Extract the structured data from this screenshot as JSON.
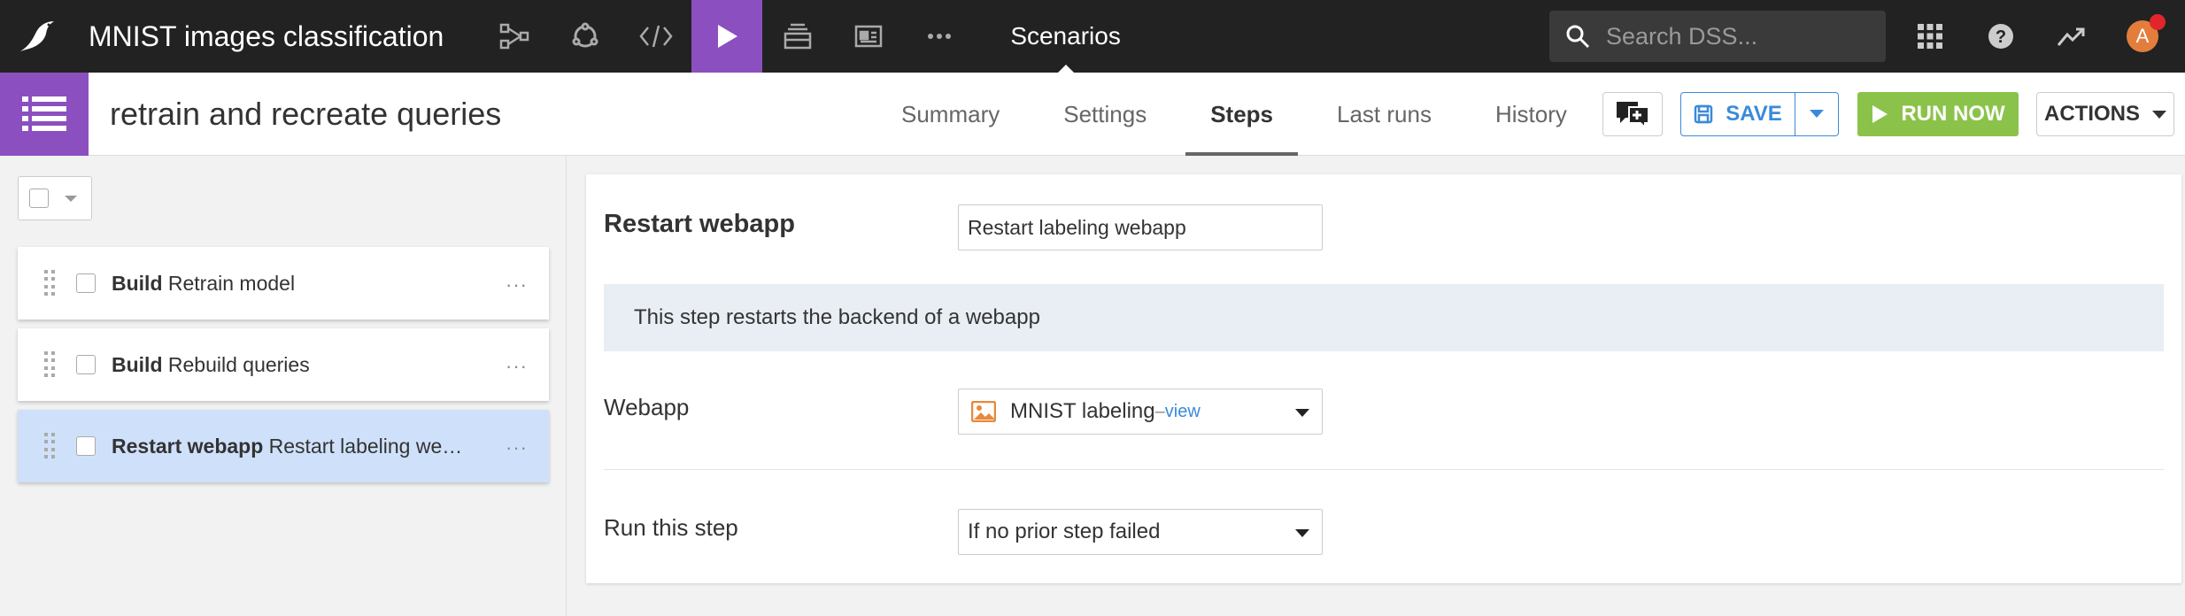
{
  "topnav": {
    "project_title": "MNIST images classification",
    "section": "Scenarios",
    "search_placeholder": "Search DSS...",
    "avatar_initial": "A",
    "icons": [
      "flow-icon",
      "lab-icon",
      "code-icon",
      "play-icon",
      "jobs-icon",
      "dashboard-icon",
      "more-icon"
    ]
  },
  "subheader": {
    "scenario_title": "retrain and recreate queries",
    "tabs": [
      "Summary",
      "Settings",
      "Steps",
      "Last runs",
      "History"
    ],
    "active_tab": "Steps",
    "save_label": "SAVE",
    "run_label": "RUN NOW",
    "actions_label": "ACTIONS"
  },
  "steps": [
    {
      "type": "Build",
      "name": "Retrain model",
      "selected": false
    },
    {
      "type": "Build",
      "name": "Rebuild queries",
      "selected": false
    },
    {
      "type": "Restart webapp",
      "name": "Restart labeling webapp",
      "display_name": "Restart labeling web…",
      "selected": true
    }
  ],
  "detail": {
    "step_type_label": "Restart webapp",
    "step_name_value": "Restart labeling webapp",
    "info_text": "This step restarts the backend of a webapp",
    "webapp_label": "Webapp",
    "webapp_value": "MNIST labeling",
    "webapp_sep": " – ",
    "webapp_view": "view",
    "run_label": "Run this step",
    "run_value": "If no prior step failed"
  },
  "colors": {
    "topnav_bg": "#222222",
    "accent_purple": "#8c4fbf",
    "save_blue": "#3b8ad9",
    "run_green": "#8bc34a",
    "selected_step_bg": "#cfe1fa",
    "info_bg": "#e8eef3"
  }
}
